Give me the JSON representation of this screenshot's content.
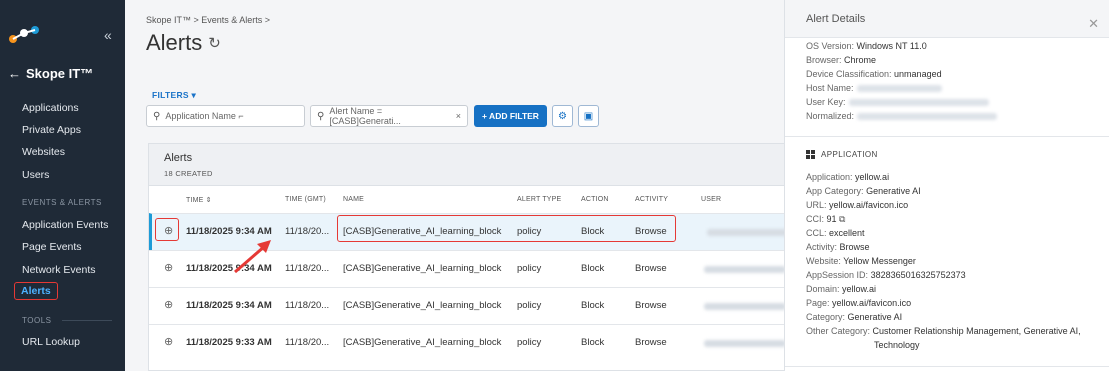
{
  "sidebar": {
    "app_title": "Skope IT™",
    "items": [
      {
        "label": "Applications"
      },
      {
        "label": "Private Apps"
      },
      {
        "label": "Websites"
      },
      {
        "label": "Users"
      }
    ],
    "section_events": "EVENTS & ALERTS",
    "event_items": [
      {
        "label": "Application Events"
      },
      {
        "label": "Page Events"
      },
      {
        "label": "Network Events"
      },
      {
        "label": "Alerts"
      }
    ],
    "section_tools": "TOOLS",
    "tool_items": [
      {
        "label": "URL Lookup"
      }
    ]
  },
  "main": {
    "breadcrumb": "Skope IT™ > Events & Alerts >",
    "title": "Alerts",
    "filters_label": "FILTERS",
    "filter_app_placeholder": "Application Name ⌐",
    "filter_alert": "Alert Name = [CASB]Generati...",
    "add_filter": "+ ADD FILTER",
    "panel_title": "Alerts",
    "panel_count": "18 CREATED",
    "columns": {
      "time": "TIME",
      "time_gmt": "TIME (GMT)",
      "name": "NAME",
      "alert_type": "ALERT TYPE",
      "action": "ACTION",
      "activity": "ACTIVITY",
      "user": "USER"
    },
    "rows": [
      {
        "time": "11/18/2025 9:34 AM",
        "time_gmt": "11/18/20...",
        "name": "[CASB]Generative_AI_learning_block",
        "alert_type": "policy",
        "action": "Block",
        "activity": "Browse"
      },
      {
        "time": "11/18/2025 9:34 AM",
        "time_gmt": "11/18/20...",
        "name": "[CASB]Generative_AI_learning_block",
        "alert_type": "policy",
        "action": "Block",
        "activity": "Browse"
      },
      {
        "time": "11/18/2025 9:34 AM",
        "time_gmt": "11/18/20...",
        "name": "[CASB]Generative_AI_learning_block",
        "alert_type": "policy",
        "action": "Block",
        "activity": "Browse"
      },
      {
        "time": "11/18/2025 9:33 AM",
        "time_gmt": "11/18/20...",
        "name": "[CASB]Generative_AI_learning_block",
        "alert_type": "policy",
        "action": "Block",
        "activity": "Browse"
      }
    ]
  },
  "detail": {
    "title": "Alert Details",
    "top_fields": [
      {
        "k": "OS Version:",
        "v": "Windows NT 11.0"
      },
      {
        "k": "Browser:",
        "v": "Chrome"
      },
      {
        "k": "Device Classification:",
        "v": "unmanaged"
      },
      {
        "k": "Host Name:",
        "v": ""
      },
      {
        "k": "User Key:",
        "v": ""
      },
      {
        "k": "Normalized:",
        "v": ""
      }
    ],
    "section_title": "APPLICATION",
    "app_fields": [
      {
        "k": "Application:",
        "v": "yellow.ai"
      },
      {
        "k": "App Category:",
        "v": "Generative AI"
      },
      {
        "k": "URL:",
        "v": "yellow.ai/favicon.ico"
      },
      {
        "k": "CCI:",
        "v": "91"
      },
      {
        "k": "CCL:",
        "v": "excellent"
      },
      {
        "k": "Activity:",
        "v": "Browse"
      },
      {
        "k": "Website:",
        "v": "Yellow Messenger"
      },
      {
        "k": "AppSession ID:",
        "v": "3828365016325752373"
      },
      {
        "k": "Domain:",
        "v": "yellow.ai"
      },
      {
        "k": "Page:",
        "v": "yellow.ai/favicon.ico"
      },
      {
        "k": "Category:",
        "v": "Generative AI"
      },
      {
        "k": "Other Category:",
        "v": "Customer Relationship Management, Generative AI,"
      },
      {
        "k": "",
        "v": "Technology"
      }
    ]
  }
}
